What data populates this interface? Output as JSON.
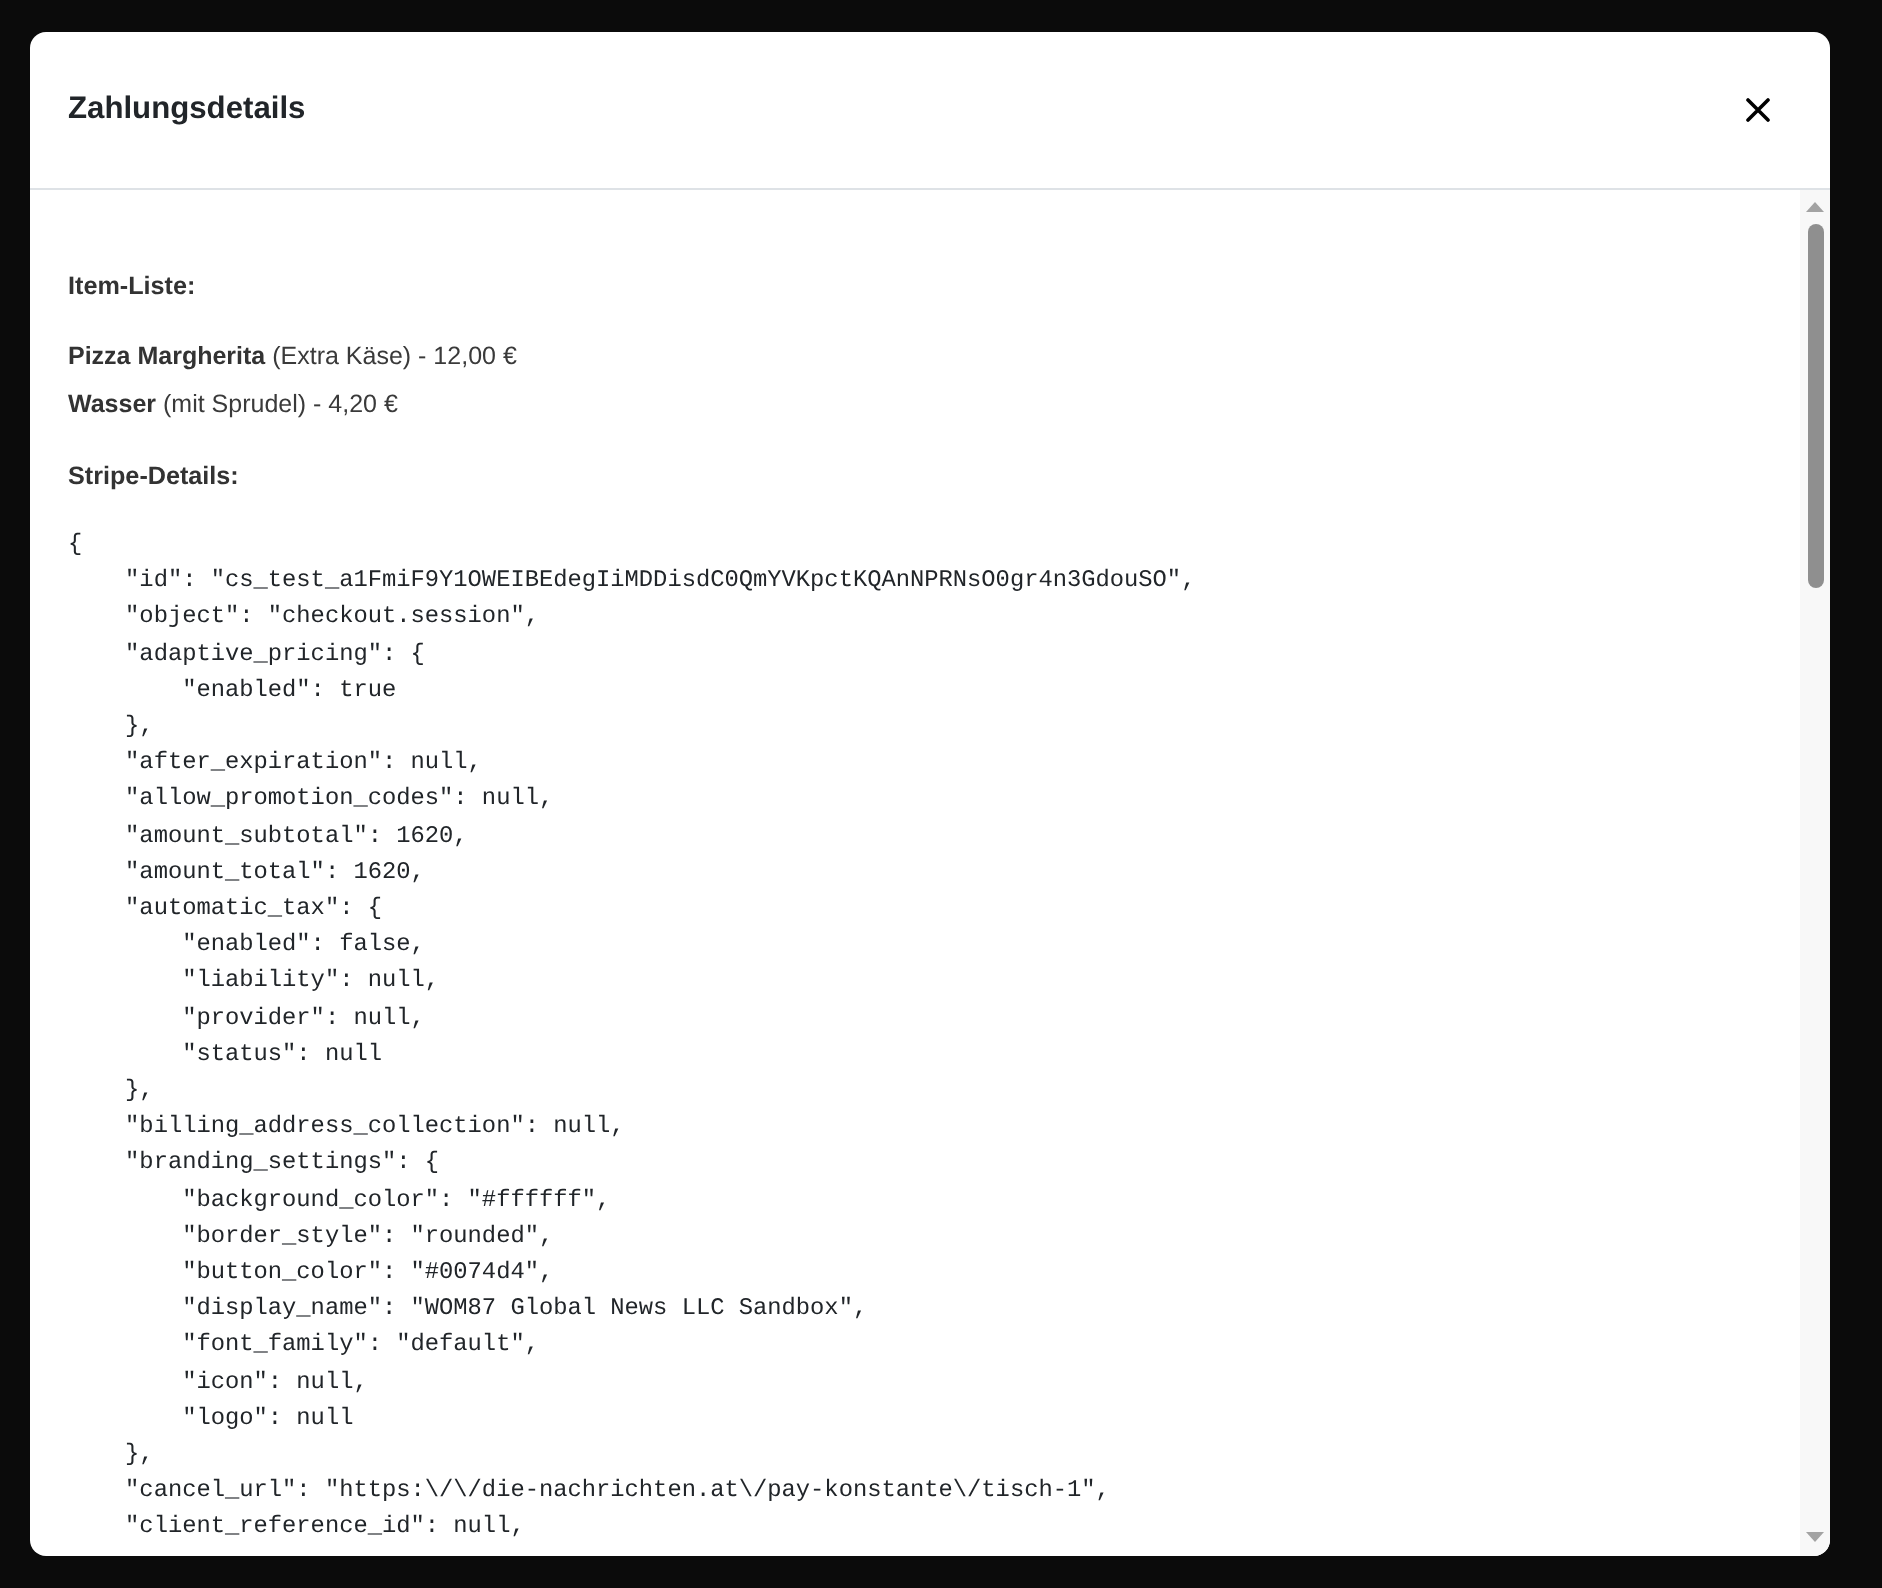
{
  "dialog": {
    "title": "Zahlungsdetails"
  },
  "item_list": {
    "heading": "Item-Liste:",
    "items": [
      "**Pizza Margherita** (Extra Käse) - 12,00 €",
      "**Wasser** (mit Sprudel) - 4,20 €"
    ]
  },
  "stripe_details": {
    "heading": "Stripe-Details:",
    "code": "{\n    \"id\": \"cs_test_a1FmiF9Y1OWEIBEdegIiMDDisdC0QmYVKpctKQAnNPRNsO0gr4n3GdouSO\",\n    \"object\": \"checkout.session\",\n    \"adaptive_pricing\": {\n        \"enabled\": true\n    },\n    \"after_expiration\": null,\n    \"allow_promotion_codes\": null,\n    \"amount_subtotal\": 1620,\n    \"amount_total\": 1620,\n    \"automatic_tax\": {\n        \"enabled\": false,\n        \"liability\": null,\n        \"provider\": null,\n        \"status\": null\n    },\n    \"billing_address_collection\": null,\n    \"branding_settings\": {\n        \"background_color\": \"#ffffff\",\n        \"border_style\": \"rounded\",\n        \"button_color\": \"#0074d4\",\n        \"display_name\": \"WOM87 Global News LLC Sandbox\",\n        \"font_family\": \"default\",\n        \"icon\": null,\n        \"logo\": null\n    },\n    \"cancel_url\": \"https:\\/\\/die-nachrichten.at\\/pay-konstante\\/tisch-1\",\n    \"client_reference_id\": null,"
  }
}
